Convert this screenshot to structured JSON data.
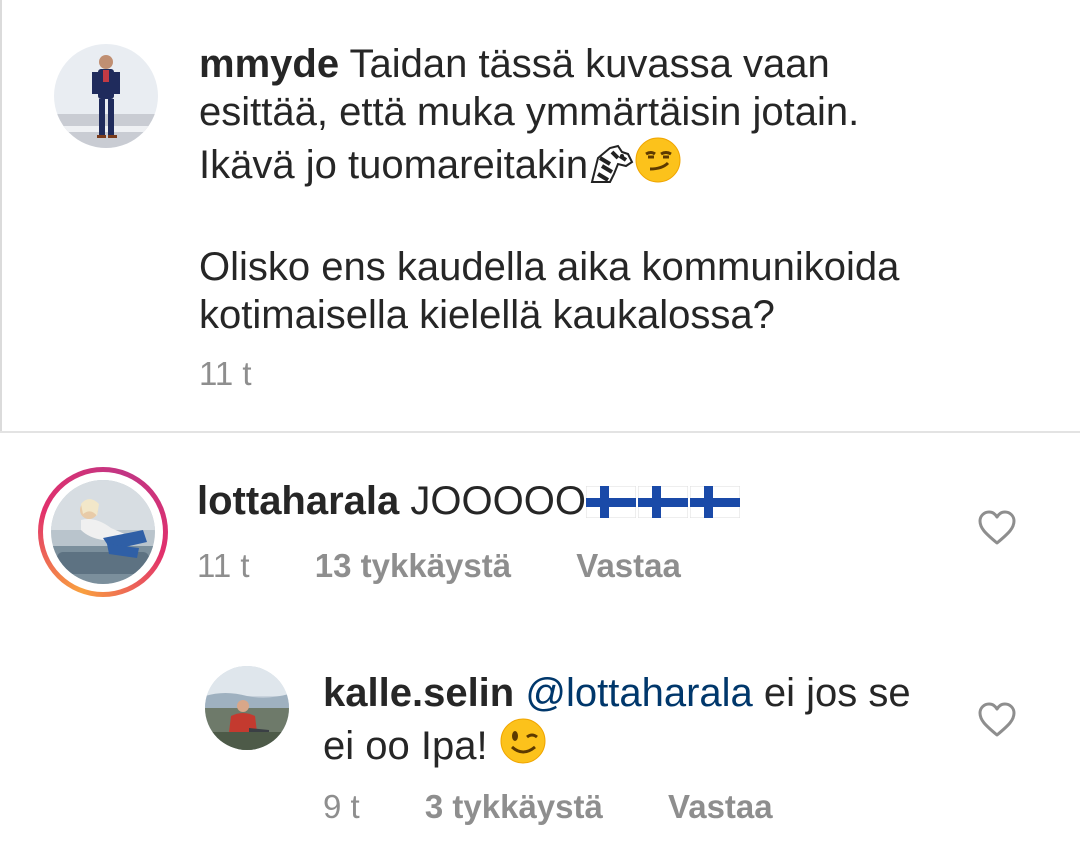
{
  "comments": [
    {
      "username": "mmyde",
      "lines": [
        "Taidan tässä kuvassa vaan",
        "esittää, että muka ymmärtäisin jotain.",
        "Ikävä jo tuomareitakin"
      ],
      "emojis": [
        "zebra-emoji",
        "smirking-face-emoji"
      ],
      "para2_lines": [
        "Olisko ens kaudella aika kommunikoida",
        "kotimaisella kielellä kaukalossa?"
      ],
      "time": "11 t"
    },
    {
      "username": "lottaharala",
      "text": "JOOOOO",
      "emojis": [
        "finland-flag-emoji",
        "finland-flag-emoji",
        "finland-flag-emoji"
      ],
      "time": "11 t",
      "likes": "13 tykkäystä",
      "reply": "Vastaa",
      "story_ring": true
    },
    {
      "username": "kalle.selin",
      "mention": "@lottaharala",
      "text_line1_rest": " ei jos se",
      "text_line2": "ei oo Ipa! ",
      "emojis": [
        "winking-face-emoji"
      ],
      "time": "9 t",
      "likes": "3 tykkäystä",
      "reply": "Vastaa"
    }
  ],
  "colors": {
    "text": "#262626",
    "meta": "#8e8e8e",
    "mention": "#00376b",
    "divider": "#e3e3e3"
  }
}
